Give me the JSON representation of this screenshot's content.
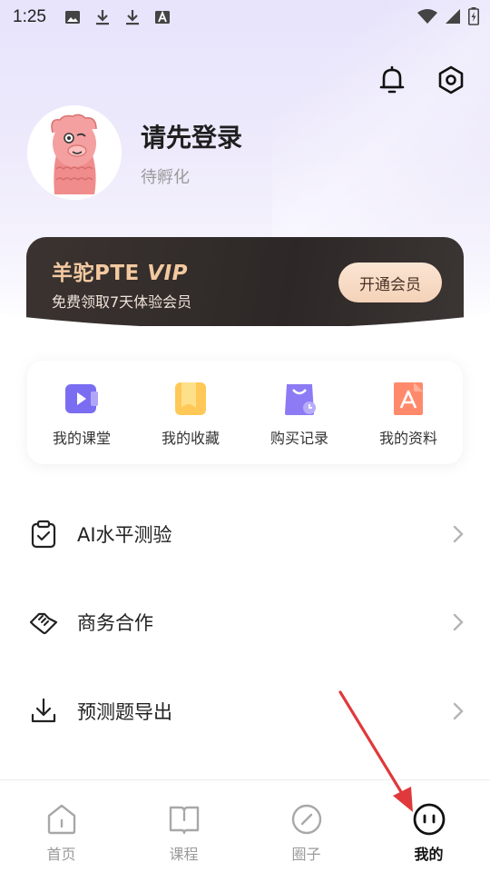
{
  "status_bar": {
    "time": "1:25",
    "icons": [
      "image-icon",
      "download-icon",
      "download-icon",
      "a-icon"
    ],
    "right_icons": [
      "wifi-icon",
      "signal-icon",
      "battery-icon"
    ]
  },
  "header": {
    "icons": [
      "bell-icon",
      "settings-icon"
    ]
  },
  "profile": {
    "username": "请先登录",
    "status": "待孵化"
  },
  "vip": {
    "title_prefix": "羊驼PTE ",
    "title_vip": "VIP",
    "subtitle": "免费领取7天体验会员",
    "button": "开通会员"
  },
  "quick_actions": [
    {
      "label": "我的课堂",
      "icon": "video-icon",
      "color": "#7b6df2"
    },
    {
      "label": "我的收藏",
      "icon": "bookmark-icon",
      "color": "#ffc857"
    },
    {
      "label": "购买记录",
      "icon": "shopping-bag-icon",
      "color": "#8c7bf5"
    },
    {
      "label": "我的资料",
      "icon": "document-icon",
      "color": "#ff8a6b"
    }
  ],
  "menu": [
    {
      "label": "AI水平测验",
      "icon": "clipboard-check-icon"
    },
    {
      "label": "商务合作",
      "icon": "handshake-icon"
    },
    {
      "label": "预测题导出",
      "icon": "download-icon"
    }
  ],
  "bottom_nav": [
    {
      "label": "首页",
      "icon": "home-icon",
      "active": false
    },
    {
      "label": "课程",
      "icon": "book-icon",
      "active": false
    },
    {
      "label": "圈子",
      "icon": "compass-icon",
      "active": false
    },
    {
      "label": "我的",
      "icon": "face-icon",
      "active": true
    }
  ],
  "colors": {
    "accent": "#7b6df2",
    "vip_gold": "#f3c9a0",
    "annotation_arrow": "#e0393b"
  }
}
